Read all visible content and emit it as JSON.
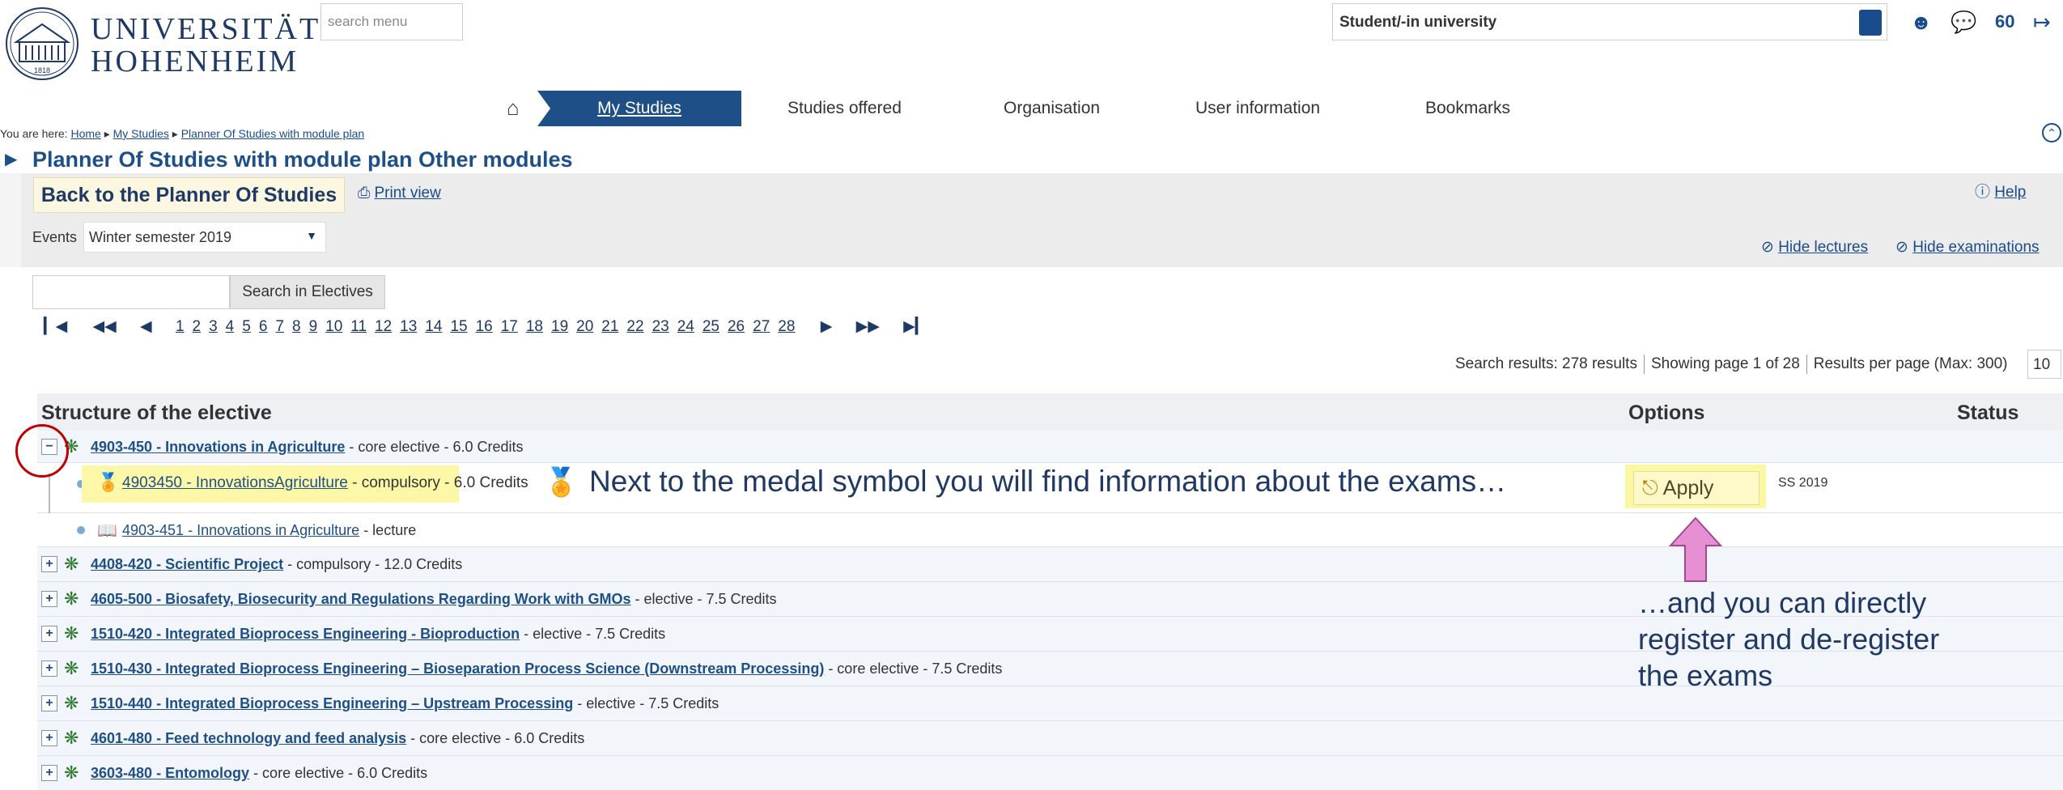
{
  "header": {
    "university_line1": "UNIVERSITÄT",
    "university_line2": "HOHENHEIM",
    "logo_year": "1818",
    "search_placeholder": "search menu",
    "role": "Student/-in university",
    "counter": "60",
    "icons": [
      "role-switch-icon",
      "user-icon",
      "chat-add-icon",
      "logout-icon"
    ]
  },
  "nav": {
    "home_icon": "home-icon",
    "items": [
      "My Studies",
      "Studies offered",
      "Organisation",
      "User information",
      "Bookmarks"
    ],
    "active_index": 0
  },
  "breadcrumb": {
    "prefix": "You are here:",
    "items": [
      "Home",
      "My Studies",
      "Planner Of Studies with module plan"
    ]
  },
  "page": {
    "title": "Planner Of Studies with module plan Other modules",
    "back_button": "Back to the Planner Of Studies",
    "print": "Print view",
    "help": "Help",
    "events_label": "Events",
    "events_value": "Winter semester 2019",
    "hide_lectures": "Hide lectures",
    "hide_examinations": "Hide examinations",
    "search_button": "Search in Electives",
    "search_value": ""
  },
  "pager": {
    "pages": [
      "1",
      "2",
      "3",
      "4",
      "5",
      "6",
      "7",
      "8",
      "9",
      "10",
      "11",
      "12",
      "13",
      "14",
      "15",
      "16",
      "17",
      "18",
      "19",
      "20",
      "21",
      "22",
      "23",
      "24",
      "25",
      "26",
      "27",
      "28"
    ]
  },
  "results": {
    "found": "Search results: 278 results",
    "showing": "Showing page 1 of 28",
    "per_page_label": "Results per page (Max: 300)",
    "per_page_value": "10"
  },
  "table": {
    "headers": {
      "structure": "Structure of the elective",
      "options": "Options",
      "status": "Status"
    },
    "module_row": {
      "title": "4903-450 - Innovations in Agriculture",
      "suffix": " - core elective - 6.0 Credits"
    },
    "exam_row": {
      "title": "4903450 - InnovationsAgriculture",
      "suffix": " - compulsory",
      "credits": " - 6.0 Credits",
      "apply": "Apply",
      "semester": "SS 2019"
    },
    "lecture_row": {
      "title": "4903-451 - Innovations in Agriculture",
      "suffix": " - lecture"
    },
    "rows": [
      {
        "title": "4408-420 - Scientific Project",
        "suffix": " - compulsory - 12.0 Credits"
      },
      {
        "title": "4605-500 - Biosafety, Biosecurity and Regulations Regarding Work with GMOs",
        "suffix": " - elective - 7.5 Credits"
      },
      {
        "title": "1510-420 - Integrated Bioprocess Engineering - Bioproduction",
        "suffix": " - elective - 7.5 Credits"
      },
      {
        "title": "1510-430 - Integrated Bioprocess Engineering – Bioseparation Process Science (Downstream Processing)",
        "suffix": " - core elective - 7.5 Credits"
      },
      {
        "title": "1510-440 - Integrated Bioprocess Engineering – Upstream Processing",
        "suffix": " - elective - 7.5 Credits"
      },
      {
        "title": "4601-480 - Feed technology and feed analysis",
        "suffix": " - core elective - 6.0 Credits"
      },
      {
        "title": "3603-480 - Entomology",
        "suffix": " - core elective - 6.0 Credits"
      }
    ]
  },
  "annotations": {
    "note1": "Next to the medal symbol you will find information about the exams…",
    "note2_line1": "…and you can directly",
    "note2_line2": "register and de-register",
    "note2_line3": "the exams"
  },
  "colors": {
    "brand_blue": "#1e4f87",
    "highlight_yellow": "#fcf8a8",
    "annotation_circle": "#c00000",
    "arrow_pink": "#e68fd2"
  }
}
